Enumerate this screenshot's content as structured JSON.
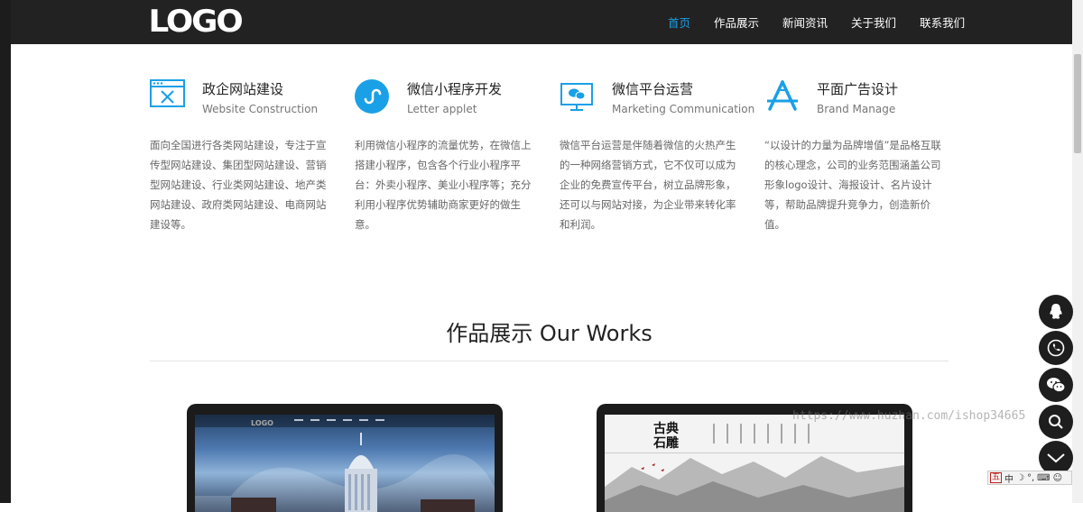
{
  "header": {
    "logo": "LOGO",
    "nav": [
      "首页",
      "作品展示",
      "新闻资讯",
      "关于我们",
      "联系我们"
    ],
    "active_index": 0
  },
  "services": [
    {
      "icon": "website-construction-icon",
      "title": "政企网站建设",
      "subtitle": "Website Construction",
      "description": "面向全国进行各类网站建设，专注于宣传型网站建设、集团型网站建设、营销型网站建设、行业类网站建设、地产类网站建设、政府类网站建设、电商网站建设等。"
    },
    {
      "icon": "mini-program-icon",
      "title": "微信小程序开发",
      "subtitle": "Letter applet",
      "description": "利用微信小程序的流量优势，在微信上搭建小程序，包含各个行业小程序平台：外卖小程序、美业小程序等；充分利用小程序优势辅助商家更好的做生意。"
    },
    {
      "icon": "wechat-platform-icon",
      "title": "微信平台运营",
      "subtitle": "Marketing Communication",
      "description": "微信平台运营是伴随着微信的火热产生的一种网络营销方式，它不仅可以成为企业的免费宣传平台，树立品牌形象，还可以与网站对接，为企业带来转化率和利润。"
    },
    {
      "icon": "graphic-design-icon",
      "title": "平面广告设计",
      "subtitle": "Brand Manage",
      "description": "“以设计的力量为品牌增值”是品格互联的核心理念，公司的业务范围涵盖公司形象logo设计、海报设计、名片设计等，帮助品牌提升竞争力，创造新价值。"
    }
  ],
  "works": {
    "title": "作品展示 Our Works",
    "items": [
      {
        "logo": "LOGO"
      },
      {
        "logo": "古典\n石雕"
      }
    ]
  },
  "watermark": "https://www.huzhan.com/ishop34665",
  "ime": {
    "label": "五",
    "mode": "中"
  },
  "colors": {
    "accent": "#1aa0e6",
    "header_bg": "#222222",
    "float_bg": "#1e1e1e"
  }
}
